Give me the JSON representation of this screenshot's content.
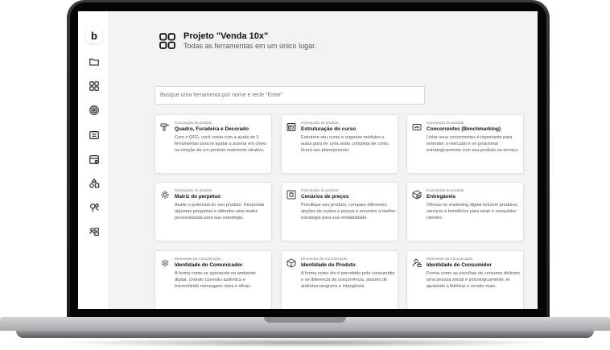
{
  "app": {
    "logo_letter": "b",
    "sidebar_icons": [
      "folder-icon",
      "grid-icon",
      "target-icon",
      "id-card-icon",
      "calendar-icon",
      "shapes-icon",
      "pin-icon",
      "persona-icon"
    ]
  },
  "header": {
    "title": "Projeto \"Venda 10x\"",
    "subtitle": "Todas as ferramentas em um único lugar."
  },
  "search": {
    "placeholder": "Busque uma ferramenta por nome e tecle \"Enter\""
  },
  "cards": [
    {
      "category": "Concepção do produto",
      "title": "Quadro, Furadeira e Decorado",
      "description": "Com o QFD, você conta com a ajuda de 3 ferramentas para te ajudar a acertar em cheio na criação de um produto realmente atrativo.",
      "icon": "drill-icon"
    },
    {
      "category": "Concepção do produto",
      "title": "Estruturação do curso",
      "description": "Estrutere seu curso e organize módulos e aulas para ter uma visão completa de como ficará seu planejamento.",
      "icon": "layout-icon"
    },
    {
      "category": "Concepção do produto",
      "title": "Concorrentes (Benchmarking)",
      "description": "Listar seus concorrentes é importante para entender o mercado e se posicionar estrategicamente com seu produto ou serviço.",
      "icon": "binoculars-icon"
    },
    {
      "category": "Concepção do produto",
      "title": "Matriz do perpétuo",
      "description": "Avalie o potencial do seu produto. Responda algumas perguntas e obtenha uma matriz personalizada para sua estratégia.",
      "icon": "matrix-icon"
    },
    {
      "category": "Concepção do produto",
      "title": "Cenários de preços",
      "description": "Precifique seu produto, compare diferentes opções de custos e preços e encontre a melhor estratégia para sua rentabilidade.",
      "icon": "price-icon"
    },
    {
      "category": "Concepção do produto",
      "title": "Entregáveis",
      "description": "Ofertas no marketing digital incluem produtos, serviços e benefícios para atrair e conquistar clientes.",
      "icon": "package-icon"
    },
    {
      "category": "Elementos da Comunicação",
      "title": "Identidade do Comunicador",
      "description": "A forma como se apresenta no ambiente digital, criando conexão autêntica e transmitindo mensagem clara e eficaz.",
      "icon": "fingerprint-icon"
    },
    {
      "category": "Elementos da Comunicação",
      "title": "Identidade do Produto",
      "description": "A forma como ele é percebido pelo consumidor e se diferencia da concorrência, através de atributos tangíveis e intangíveis.",
      "icon": "box-icon"
    },
    {
      "category": "Elementos da Comunicação",
      "title": "Identidade do Consumidor",
      "description": "Forma como as escolhas de consumo definem uma pessoa social e psicologicamente, te ajudando a fidelizar e vender mais.",
      "icon": "user-lock-icon"
    }
  ]
}
